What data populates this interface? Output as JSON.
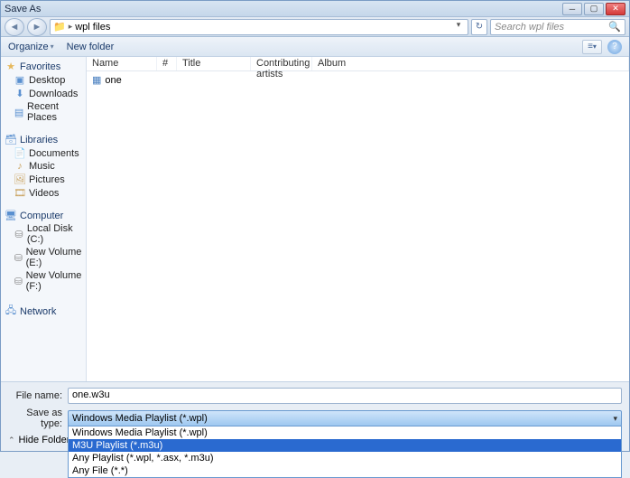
{
  "window": {
    "title": "Save As"
  },
  "address": {
    "location": "wpl files"
  },
  "search": {
    "placeholder": "Search wpl files"
  },
  "toolbar": {
    "organize": "Organize",
    "new_folder": "New folder"
  },
  "sidebar": {
    "favorites": {
      "label": "Favorites",
      "items": [
        "Desktop",
        "Downloads",
        "Recent Places"
      ]
    },
    "libraries": {
      "label": "Libraries",
      "items": [
        "Documents",
        "Music",
        "Pictures",
        "Videos"
      ]
    },
    "computer": {
      "label": "Computer",
      "items": [
        "Local Disk (C:)",
        "New Volume (E:)",
        "New Volume (F:)"
      ]
    },
    "network": {
      "label": "Network"
    }
  },
  "columns": {
    "name": "Name",
    "num": "#",
    "title": "Title",
    "ca": "Contributing artists",
    "album": "Album"
  },
  "files": [
    {
      "name": "one"
    }
  ],
  "form": {
    "file_name_label": "File name:",
    "file_name_value": "one.w3u",
    "save_type_label": "Save as type:",
    "save_type_value": "Windows Media Playlist (*.wpl)",
    "hide_folders": "Hide Folders"
  },
  "type_options": [
    "Windows Media Playlist (*.wpl)",
    "M3U Playlist (*.m3u)",
    "Any Playlist (*.wpl, *.asx, *.m3u)",
    "Any File (*.*)"
  ]
}
